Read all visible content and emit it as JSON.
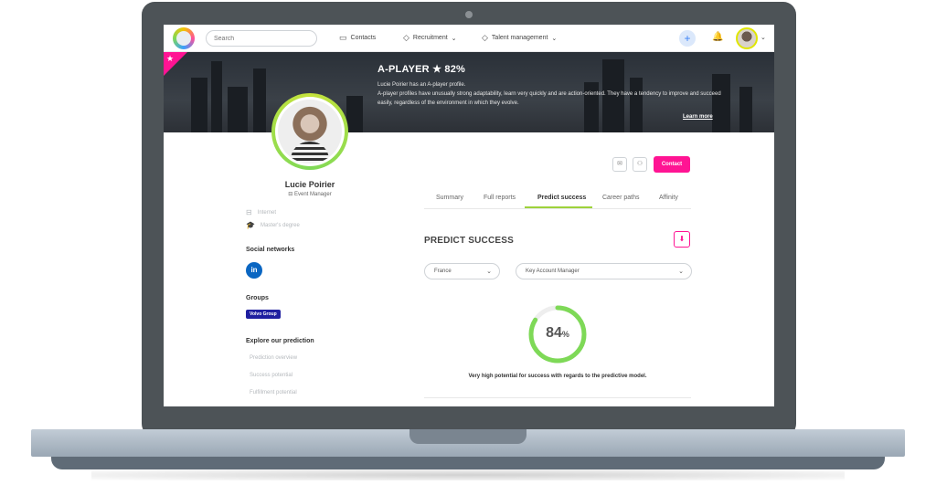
{
  "nav": {
    "search_placeholder": "Search",
    "contacts": "Contacts",
    "recruitment": "Recruitment",
    "talent_management": "Talent management"
  },
  "banner": {
    "title": "A-PLAYER ★ 82%",
    "line1": "Lucie Poirier has an A-player profile.",
    "line2": "A-player profiles have unusually strong adaptability, learn very quickly and are action-oriented. They have a tendency to improve and succeed easily, regardless of the environment in which they evolve.",
    "learn_more": "Learn more",
    "ribbon_color": "#ff1493"
  },
  "profile": {
    "name": "Lucie Poirier",
    "role": "Event Manager",
    "info": [
      "Internet",
      "Master's degree"
    ]
  },
  "sidebar": {
    "social_title": "Social networks",
    "linkedin": "in",
    "groups_title": "Groups",
    "group_badge": "Volvo Group",
    "explore_title": "Explore our prediction",
    "explore_items": [
      "Prediction overview",
      "Success potential",
      "Fulfillment potential"
    ]
  },
  "actions": {
    "contact": "Contact"
  },
  "tabs": [
    "Summary",
    "Full reports",
    "Predict success",
    "Career paths",
    "Affinity"
  ],
  "active_tab": "Predict success",
  "predict": {
    "heading": "PREDICT SUCCESS",
    "country": "France",
    "position": "Key Account Manager",
    "score_value": "84",
    "score_unit": "%",
    "score_fraction": 0.84,
    "caption": "Very high potential for success with regards to the predictive model.",
    "accent_color": "#7ed957"
  }
}
